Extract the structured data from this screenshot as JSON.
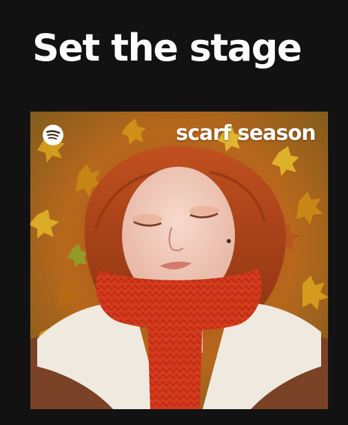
{
  "section": {
    "title": "Set the stage"
  },
  "playlist_card": {
    "cover_title": "scarf season",
    "logo_icon": "spotify-logo-icon"
  },
  "colors": {
    "background": "#121212",
    "text": "#ffffff",
    "scarf": "#d63a1c",
    "hair": "#b5431a",
    "leaves": "#c9861e",
    "coat": "#7a4226"
  }
}
